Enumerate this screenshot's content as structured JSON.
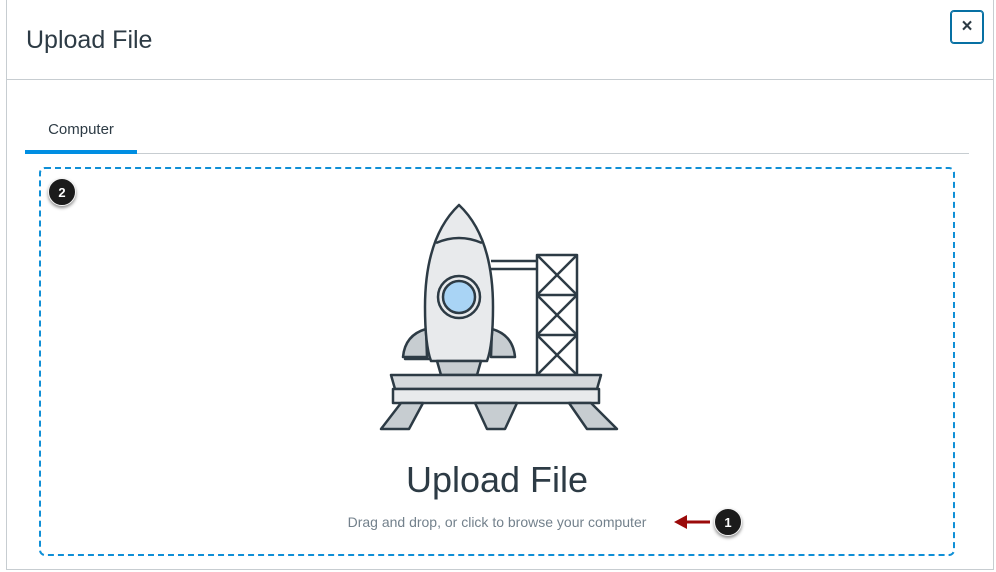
{
  "dialog": {
    "title": "Upload File",
    "close_label": "×"
  },
  "tabs": [
    {
      "label": "Computer",
      "selected": true
    }
  ],
  "dropzone": {
    "title": "Upload File",
    "subtitle": "Drag and drop, or click to browse your computer"
  },
  "callouts": [
    {
      "number": "1"
    },
    {
      "number": "2"
    }
  ],
  "colors": {
    "accent": "#008ee2",
    "dashed_border": "#0f8fd6",
    "close_border": "#0770a3",
    "callout_arrow": "#9b0a0a"
  }
}
